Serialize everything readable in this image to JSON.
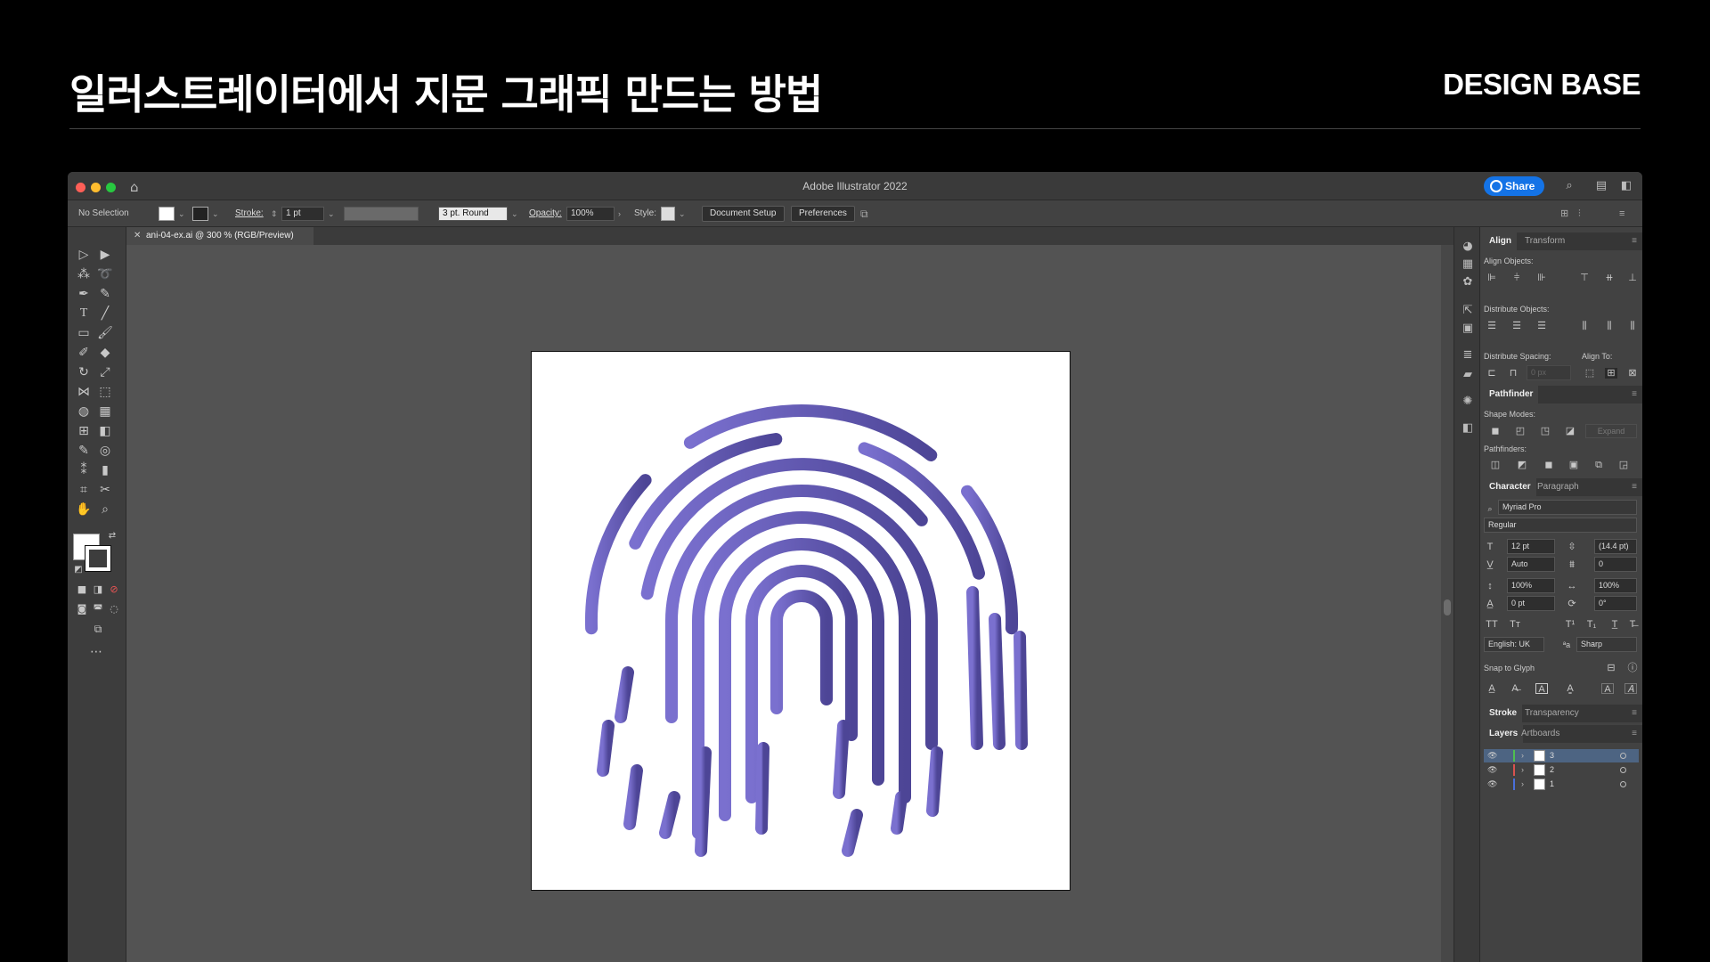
{
  "header": {
    "title": "일러스트레이터에서 지문 그래픽 만드는 방법",
    "brand": "DESIGN BASE"
  },
  "app": {
    "window_title": "Adobe Illustrator 2022",
    "share_label": "Share",
    "control_bar": {
      "selection": "No Selection",
      "stroke_label": "Stroke:",
      "stroke_value": "1 pt",
      "brush": "3 pt. Round",
      "opacity_label": "Opacity:",
      "opacity_value": "100%",
      "style_label": "Style:",
      "document_setup": "Document Setup",
      "preferences": "Preferences"
    },
    "document_tab": "ani-04-ex.ai @ 300 % (RGB/Preview)",
    "artwork": {
      "name": "fingerprint",
      "gradient_start": "#7a70cf",
      "gradient_end": "#4d4596"
    },
    "panels": {
      "align": {
        "tab_active": "Align",
        "tab_other": "Transform",
        "align_objects": "Align Objects:",
        "distribute_objects": "Distribute Objects:",
        "distribute_spacing": "Distribute Spacing:",
        "align_to": "Align To:",
        "spacing_value": "0 px"
      },
      "pathfinder": {
        "tab": "Pathfinder",
        "shape_modes": "Shape Modes:",
        "expand": "Expand",
        "pathfinders": "Pathfinders:"
      },
      "character": {
        "tab_active": "Character",
        "tab_other": "Paragraph",
        "font_family": "Myriad Pro",
        "font_style": "Regular",
        "font_size": "12 pt",
        "leading": "(14.4 pt)",
        "kerning": "Auto",
        "tracking": "0",
        "vertical_scale": "100%",
        "horizontal_scale": "100%",
        "baseline_shift": "0 pt",
        "rotation": "0°",
        "language": "English: UK",
        "antialias": "Sharp",
        "snap_to_glyph": "Snap to Glyph"
      },
      "stroke": {
        "tab_active": "Stroke",
        "tab_other": "Transparency"
      },
      "layers": {
        "tab_active": "Layers",
        "tab_other": "Artboards",
        "items": [
          {
            "name": "3",
            "color": "#4fbf4f",
            "selected": true
          },
          {
            "name": "2",
            "color": "#d9534f",
            "selected": false
          },
          {
            "name": "1",
            "color": "#4a6fd9",
            "selected": false
          }
        ]
      }
    }
  }
}
